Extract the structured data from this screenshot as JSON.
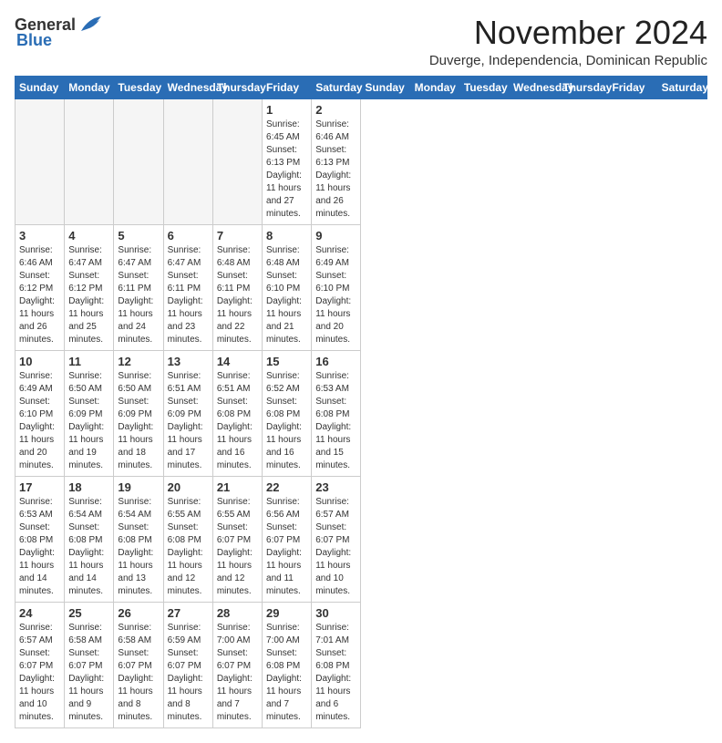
{
  "header": {
    "logo_general": "General",
    "logo_blue": "Blue",
    "month_title": "November 2024",
    "location": "Duverge, Independencia, Dominican Republic"
  },
  "days_of_week": [
    "Sunday",
    "Monday",
    "Tuesday",
    "Wednesday",
    "Thursday",
    "Friday",
    "Saturday"
  ],
  "weeks": [
    [
      {
        "day": "",
        "empty": true
      },
      {
        "day": "",
        "empty": true
      },
      {
        "day": "",
        "empty": true
      },
      {
        "day": "",
        "empty": true
      },
      {
        "day": "",
        "empty": true
      },
      {
        "day": "1",
        "sunrise": "Sunrise: 6:45 AM",
        "sunset": "Sunset: 6:13 PM",
        "daylight": "Daylight: 11 hours and 27 minutes."
      },
      {
        "day": "2",
        "sunrise": "Sunrise: 6:46 AM",
        "sunset": "Sunset: 6:13 PM",
        "daylight": "Daylight: 11 hours and 26 minutes."
      }
    ],
    [
      {
        "day": "3",
        "sunrise": "Sunrise: 6:46 AM",
        "sunset": "Sunset: 6:12 PM",
        "daylight": "Daylight: 11 hours and 26 minutes."
      },
      {
        "day": "4",
        "sunrise": "Sunrise: 6:47 AM",
        "sunset": "Sunset: 6:12 PM",
        "daylight": "Daylight: 11 hours and 25 minutes."
      },
      {
        "day": "5",
        "sunrise": "Sunrise: 6:47 AM",
        "sunset": "Sunset: 6:11 PM",
        "daylight": "Daylight: 11 hours and 24 minutes."
      },
      {
        "day": "6",
        "sunrise": "Sunrise: 6:47 AM",
        "sunset": "Sunset: 6:11 PM",
        "daylight": "Daylight: 11 hours and 23 minutes."
      },
      {
        "day": "7",
        "sunrise": "Sunrise: 6:48 AM",
        "sunset": "Sunset: 6:11 PM",
        "daylight": "Daylight: 11 hours and 22 minutes."
      },
      {
        "day": "8",
        "sunrise": "Sunrise: 6:48 AM",
        "sunset": "Sunset: 6:10 PM",
        "daylight": "Daylight: 11 hours and 21 minutes."
      },
      {
        "day": "9",
        "sunrise": "Sunrise: 6:49 AM",
        "sunset": "Sunset: 6:10 PM",
        "daylight": "Daylight: 11 hours and 20 minutes."
      }
    ],
    [
      {
        "day": "10",
        "sunrise": "Sunrise: 6:49 AM",
        "sunset": "Sunset: 6:10 PM",
        "daylight": "Daylight: 11 hours and 20 minutes."
      },
      {
        "day": "11",
        "sunrise": "Sunrise: 6:50 AM",
        "sunset": "Sunset: 6:09 PM",
        "daylight": "Daylight: 11 hours and 19 minutes."
      },
      {
        "day": "12",
        "sunrise": "Sunrise: 6:50 AM",
        "sunset": "Sunset: 6:09 PM",
        "daylight": "Daylight: 11 hours and 18 minutes."
      },
      {
        "day": "13",
        "sunrise": "Sunrise: 6:51 AM",
        "sunset": "Sunset: 6:09 PM",
        "daylight": "Daylight: 11 hours and 17 minutes."
      },
      {
        "day": "14",
        "sunrise": "Sunrise: 6:51 AM",
        "sunset": "Sunset: 6:08 PM",
        "daylight": "Daylight: 11 hours and 16 minutes."
      },
      {
        "day": "15",
        "sunrise": "Sunrise: 6:52 AM",
        "sunset": "Sunset: 6:08 PM",
        "daylight": "Daylight: 11 hours and 16 minutes."
      },
      {
        "day": "16",
        "sunrise": "Sunrise: 6:53 AM",
        "sunset": "Sunset: 6:08 PM",
        "daylight": "Daylight: 11 hours and 15 minutes."
      }
    ],
    [
      {
        "day": "17",
        "sunrise": "Sunrise: 6:53 AM",
        "sunset": "Sunset: 6:08 PM",
        "daylight": "Daylight: 11 hours and 14 minutes."
      },
      {
        "day": "18",
        "sunrise": "Sunrise: 6:54 AM",
        "sunset": "Sunset: 6:08 PM",
        "daylight": "Daylight: 11 hours and 14 minutes."
      },
      {
        "day": "19",
        "sunrise": "Sunrise: 6:54 AM",
        "sunset": "Sunset: 6:08 PM",
        "daylight": "Daylight: 11 hours and 13 minutes."
      },
      {
        "day": "20",
        "sunrise": "Sunrise: 6:55 AM",
        "sunset": "Sunset: 6:08 PM",
        "daylight": "Daylight: 11 hours and 12 minutes."
      },
      {
        "day": "21",
        "sunrise": "Sunrise: 6:55 AM",
        "sunset": "Sunset: 6:07 PM",
        "daylight": "Daylight: 11 hours and 12 minutes."
      },
      {
        "day": "22",
        "sunrise": "Sunrise: 6:56 AM",
        "sunset": "Sunset: 6:07 PM",
        "daylight": "Daylight: 11 hours and 11 minutes."
      },
      {
        "day": "23",
        "sunrise": "Sunrise: 6:57 AM",
        "sunset": "Sunset: 6:07 PM",
        "daylight": "Daylight: 11 hours and 10 minutes."
      }
    ],
    [
      {
        "day": "24",
        "sunrise": "Sunrise: 6:57 AM",
        "sunset": "Sunset: 6:07 PM",
        "daylight": "Daylight: 11 hours and 10 minutes."
      },
      {
        "day": "25",
        "sunrise": "Sunrise: 6:58 AM",
        "sunset": "Sunset: 6:07 PM",
        "daylight": "Daylight: 11 hours and 9 minutes."
      },
      {
        "day": "26",
        "sunrise": "Sunrise: 6:58 AM",
        "sunset": "Sunset: 6:07 PM",
        "daylight": "Daylight: 11 hours and 8 minutes."
      },
      {
        "day": "27",
        "sunrise": "Sunrise: 6:59 AM",
        "sunset": "Sunset: 6:07 PM",
        "daylight": "Daylight: 11 hours and 8 minutes."
      },
      {
        "day": "28",
        "sunrise": "Sunrise: 7:00 AM",
        "sunset": "Sunset: 6:07 PM",
        "daylight": "Daylight: 11 hours and 7 minutes."
      },
      {
        "day": "29",
        "sunrise": "Sunrise: 7:00 AM",
        "sunset": "Sunset: 6:08 PM",
        "daylight": "Daylight: 11 hours and 7 minutes."
      },
      {
        "day": "30",
        "sunrise": "Sunrise: 7:01 AM",
        "sunset": "Sunset: 6:08 PM",
        "daylight": "Daylight: 11 hours and 6 minutes."
      }
    ]
  ]
}
